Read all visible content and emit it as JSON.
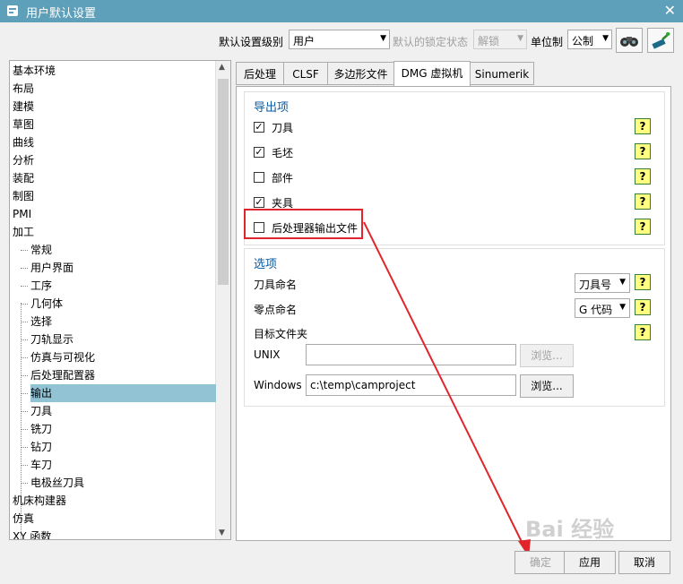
{
  "window": {
    "title": "用户默认设置",
    "close_glyph": "✕"
  },
  "toolbar": {
    "level_label": "默认设置级别",
    "level_value": "用户",
    "lock_label": "默认的锁定状态",
    "lock_value": "解锁",
    "unit_label": "单位制",
    "unit_value": "公制",
    "icons": [
      "binoculars-icon",
      "wand-icon"
    ]
  },
  "tree": {
    "items": [
      {
        "label": "基本环境",
        "level": 0
      },
      {
        "label": "布局",
        "level": 0
      },
      {
        "label": "建模",
        "level": 0
      },
      {
        "label": "草图",
        "level": 0
      },
      {
        "label": "曲线",
        "level": 0
      },
      {
        "label": "分析",
        "level": 0
      },
      {
        "label": "装配",
        "level": 0
      },
      {
        "label": "制图",
        "level": 0
      },
      {
        "label": "PMI",
        "level": 0
      },
      {
        "label": "加工",
        "level": 0
      },
      {
        "label": "常规",
        "level": 1
      },
      {
        "label": "用户界面",
        "level": 1
      },
      {
        "label": "工序",
        "level": 1
      },
      {
        "label": "几何体",
        "level": 1
      },
      {
        "label": "选择",
        "level": 1
      },
      {
        "label": "刀轨显示",
        "level": 1
      },
      {
        "label": "仿真与可视化",
        "level": 1
      },
      {
        "label": "后处理配置器",
        "level": 1
      },
      {
        "label": "输出",
        "level": 1,
        "selected": true
      },
      {
        "label": "刀具",
        "level": 1
      },
      {
        "label": "铣刀",
        "level": 1
      },
      {
        "label": "钻刀",
        "level": 1
      },
      {
        "label": "车刀",
        "level": 1
      },
      {
        "label": "电极丝刀具",
        "level": 1
      },
      {
        "label": "机床构建器",
        "level": 0
      },
      {
        "label": "仿真",
        "level": 0
      },
      {
        "label": "XY 函数",
        "level": 0
      }
    ]
  },
  "tabs": [
    "后处理",
    "CLSF",
    "多边形文件",
    "DMG 虚拟机",
    "Sinumerik"
  ],
  "active_tab": "DMG 虚拟机",
  "export_group": {
    "title": "导出项",
    "items": [
      {
        "label": "刀具",
        "checked": true
      },
      {
        "label": "毛坯",
        "checked": true
      },
      {
        "label": "部件",
        "checked": false
      },
      {
        "label": "夹具",
        "checked": true
      },
      {
        "label": "后处理器输出文件",
        "checked": false
      }
    ]
  },
  "options_group": {
    "title": "选项",
    "tool_naming_label": "刀具命名",
    "tool_naming_value": "刀具号",
    "zero_naming_label": "零点命名",
    "zero_naming_value": "G 代码",
    "target_folder_label": "目标文件夹",
    "unix_label": "UNIX",
    "unix_value": "",
    "windows_label": "Windows",
    "windows_value": "c:\\temp\\camproject",
    "browse_label": "浏览..."
  },
  "help_glyph": "?",
  "check_glyph": "✓",
  "combo_arrow": "▼",
  "scroll_up": "▲",
  "scroll_down": "▼",
  "footer": {
    "ok": "确定",
    "apply": "应用",
    "cancel": "取消"
  },
  "watermark": "Bai 经验",
  "colors": {
    "titlebar": "#5e9fb9",
    "selected": "#91c3d4",
    "annotation": "#e0262c",
    "group_title": "#0a5aa0"
  }
}
